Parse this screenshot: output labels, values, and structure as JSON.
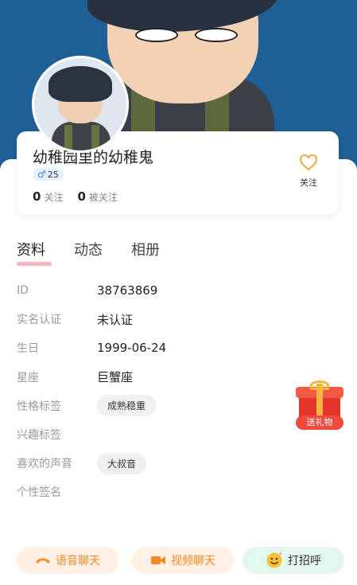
{
  "profile": {
    "nickname": "幼稚园里的幼稚鬼",
    "age": "25",
    "follow_count": "0",
    "follow_label": "关注",
    "followers_count": "0",
    "followers_label": "被关注",
    "follow_button_label": "关注"
  },
  "tabs": [
    {
      "label": "资料",
      "active": true
    },
    {
      "label": "动态",
      "active": false
    },
    {
      "label": "相册",
      "active": false
    }
  ],
  "info": {
    "id_label": "ID",
    "id_value": "38763869",
    "realname_label": "实名认证",
    "realname_value": "未认证",
    "birthday_label": "生日",
    "birthday_value": "1999-06-24",
    "zodiac_label": "星座",
    "zodiac_value": "巨蟹座",
    "personality_label": "性格标签",
    "personality_value": "成熟稳重",
    "interest_label": "兴趣标签",
    "voice_label": "喜欢的声音",
    "voice_value": "大叔音",
    "signature_label": "个性签名"
  },
  "gift": {
    "label": "送礼物"
  },
  "actions": {
    "voice_chat": "语音聊天",
    "video_chat": "视频聊天",
    "greet": "打招呼"
  },
  "colors": {
    "banner": "#1e5f95",
    "accent_orange": "#f08a28",
    "tab_underline": "#f7b3bf",
    "gender_male": "#3b8ee0"
  }
}
